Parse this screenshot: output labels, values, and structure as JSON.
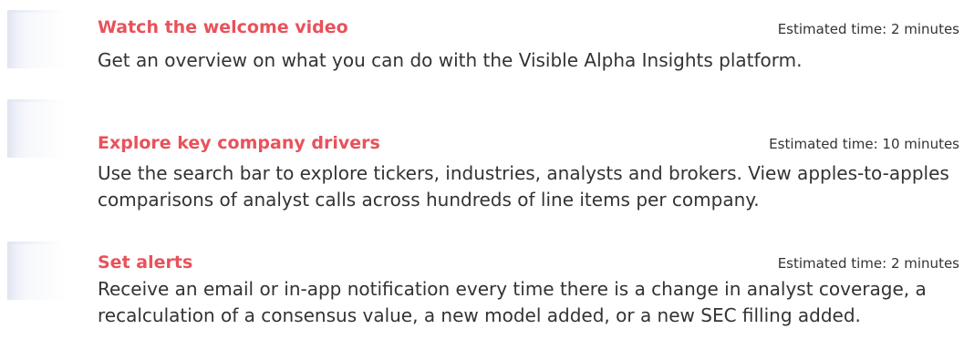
{
  "items": [
    {
      "title": "Watch the welcome video",
      "time": "Estimated time: 2 minutes",
      "description": "Get an overview on what you can do with the Visible Alpha Insights platform."
    },
    {
      "title": "Explore key company drivers",
      "time": "Estimated time: 10 minutes",
      "description": "Use the search bar to explore tickers, industries, analysts and brokers. View apples-to-apples comparisons of analyst calls across hundreds of line items per company."
    },
    {
      "title": "Set alerts",
      "time": "Estimated time: 2 minutes",
      "description": "Receive an email or in-app notification every time there is a change in analyst coverage, a recalculation of a consensus value, a new model added, or a new SEC filling added."
    }
  ],
  "colors": {
    "title": "#e8525b",
    "text": "#333333",
    "thumbnail": "#dfe4f1"
  }
}
